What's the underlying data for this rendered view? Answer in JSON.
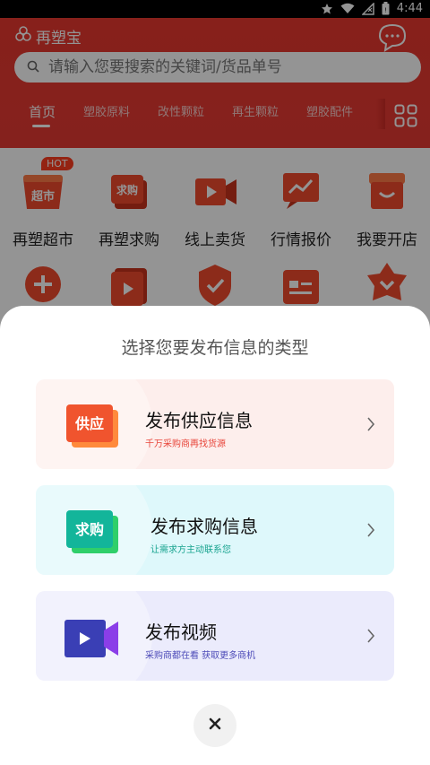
{
  "status_bar": {
    "time": "4:44"
  },
  "header": {
    "brand": "再塑宝",
    "search_placeholder": "请输入您要搜索的关键词/货品单号",
    "tabs": [
      {
        "label": "首页",
        "active": true
      },
      {
        "label": "塑胶原料"
      },
      {
        "label": "改性颗粒"
      },
      {
        "label": "再生颗粒"
      },
      {
        "label": "塑胶配件"
      }
    ]
  },
  "grid": {
    "hot_badge": "HOT",
    "items": [
      {
        "label": "再塑超市",
        "icon": "supermarket-icon",
        "icon_text": "超市"
      },
      {
        "label": "再塑求购",
        "icon": "purchase-icon",
        "icon_text": "求购"
      },
      {
        "label": "线上卖货",
        "icon": "video-sell-icon"
      },
      {
        "label": "行情报价",
        "icon": "market-trend-icon"
      },
      {
        "label": "我要开店",
        "icon": "shop-icon"
      }
    ],
    "row2_icons": [
      "plus-icon",
      "play-icon",
      "shield-check-icon",
      "card-icon",
      "star-down-icon"
    ]
  },
  "sheet": {
    "title": "选择您要发布信息的类型",
    "cards": [
      {
        "title": "发布供应信息",
        "subtitle": "千万采购商再找货源",
        "icon_text": "供应",
        "bg": "#fdeeec",
        "sub_color": "#e8463b"
      },
      {
        "title": "发布求购信息",
        "subtitle": "让需求方主动联系您",
        "icon_text": "求购",
        "bg": "#def8fb",
        "sub_color": "#17a38f"
      },
      {
        "title": "发布视频",
        "subtitle": "采购商都在看 获取更多商机",
        "bg": "#ebebfc",
        "sub_color": "#4d4bb8"
      }
    ]
  },
  "colors": {
    "brand_red": "#e63a33",
    "overlay": "rgba(0,0,0,0.42)"
  }
}
